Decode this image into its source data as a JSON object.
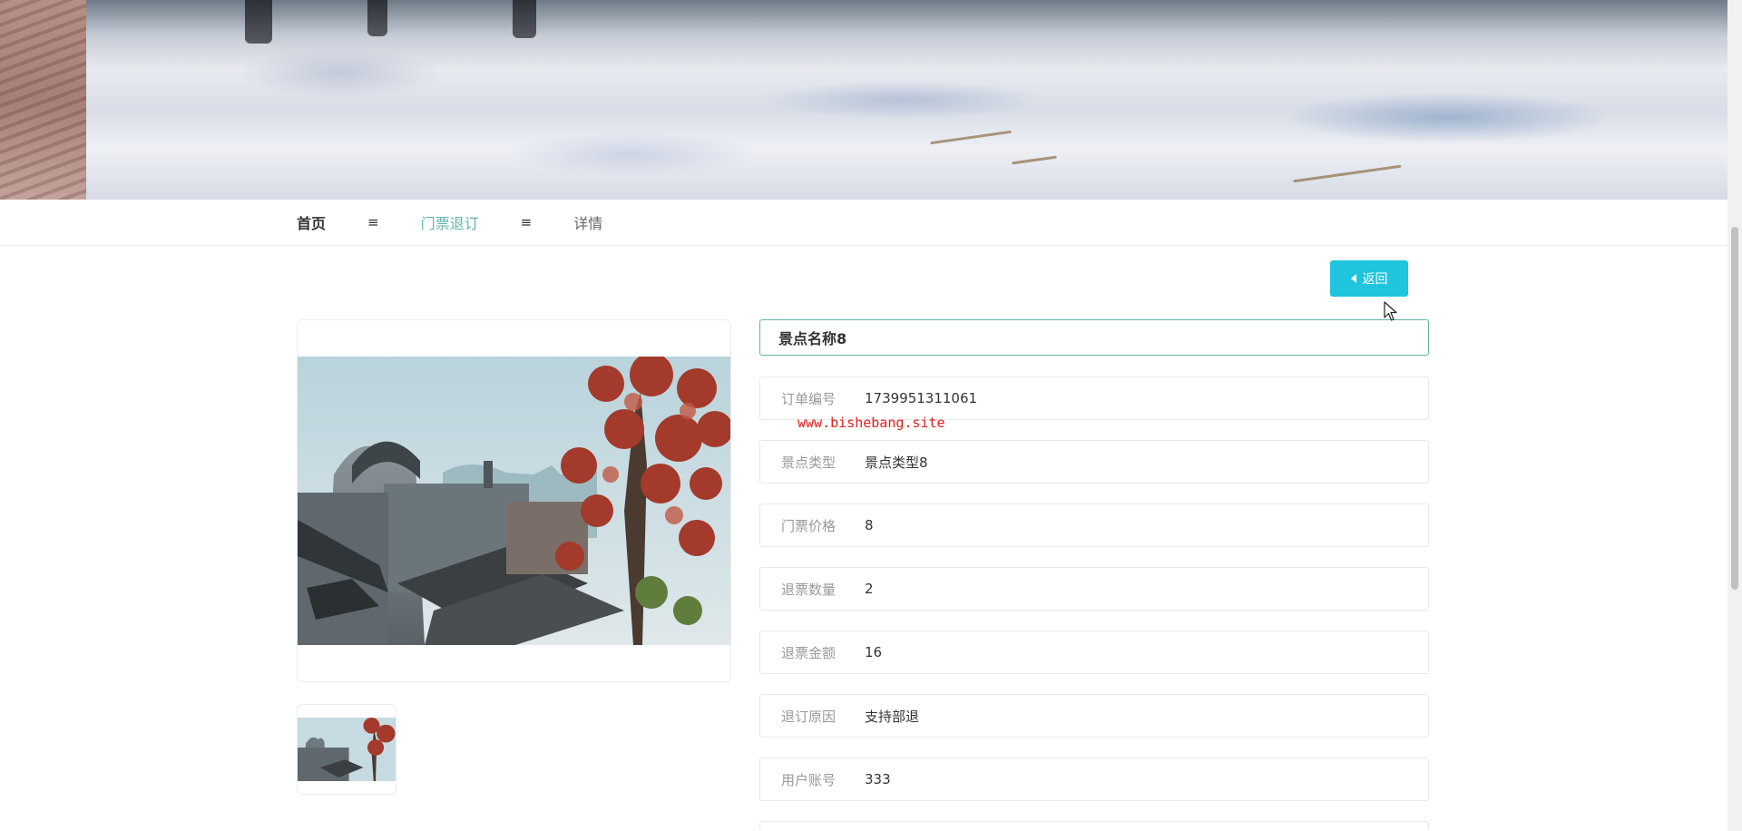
{
  "breadcrumb": {
    "home": "首页",
    "separator": "≡",
    "current": "门票退订",
    "detail": "详情"
  },
  "back_button": {
    "label": "返回"
  },
  "detail": {
    "title": "景点名称8",
    "fields": [
      {
        "label": "订单编号",
        "value": "1739951311061"
      },
      {
        "label": "景点类型",
        "value": "景点类型8"
      },
      {
        "label": "门票价格",
        "value": "8"
      },
      {
        "label": "退票数量",
        "value": "2"
      },
      {
        "label": "退票金额",
        "value": "16"
      },
      {
        "label": "退订原因",
        "value": "支持部退"
      },
      {
        "label": "用户账号",
        "value": "333"
      }
    ]
  },
  "watermark": "www.bishebang.site",
  "colors": {
    "accent": "#1fc4dd",
    "breadcrumb_active": "#5fb3b0",
    "watermark": "#e0201c"
  }
}
